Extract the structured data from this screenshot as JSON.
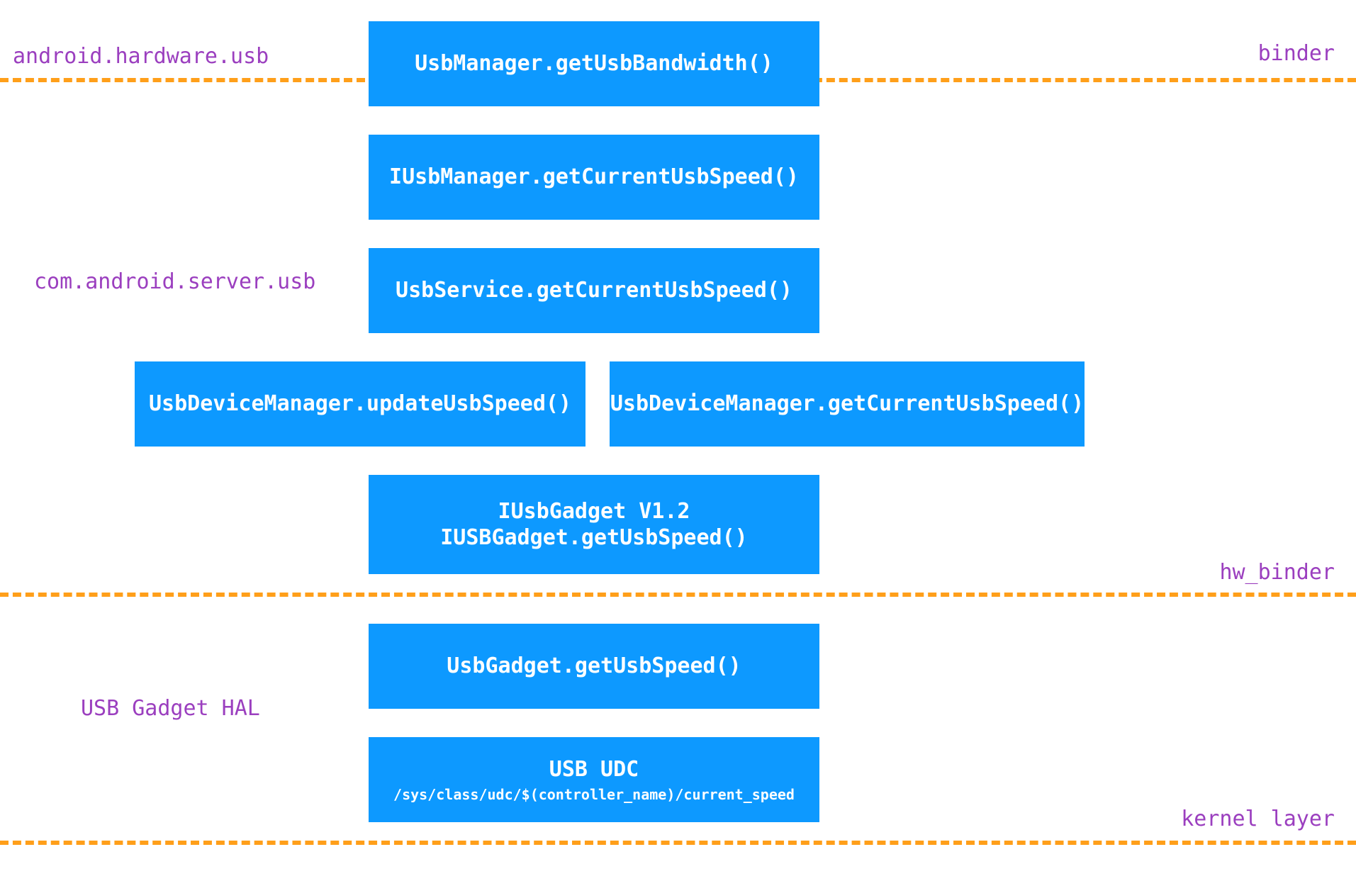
{
  "labels": {
    "left1": "android.hardware.usb",
    "left2": "com.android.server.usb",
    "left3": "USB Gadget HAL",
    "right1": "binder",
    "right2": "hw_binder",
    "right3": "kernel layer"
  },
  "boxes": {
    "b1": "UsbManager.getUsbBandwidth()",
    "b2": "IUsbManager.getCurrentUsbSpeed()",
    "b3": "UsbService.getCurrentUsbSpeed()",
    "b4a": "UsbDeviceManager.updateUsbSpeed()",
    "b4b": "UsbDeviceManager.getCurrentUsbSpeed()",
    "b5_line1": "IUsbGadget V1.2",
    "b5_line2": "IUSBGadget.getUsbSpeed()",
    "b6": "UsbGadget.getUsbSpeed()",
    "b7_line1": "USB UDC",
    "b7_line2": "/sys/class/udc/$(controller_name)/current_speed"
  }
}
